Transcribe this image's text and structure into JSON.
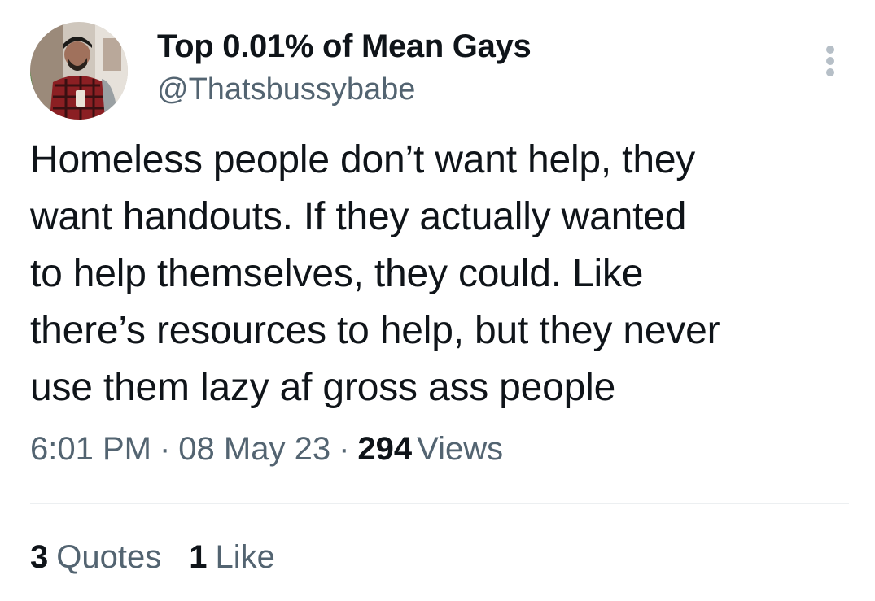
{
  "author": {
    "display_name": "Top 0.01% of Mean Gays",
    "handle": "@Thatsbussybabe"
  },
  "tweet": {
    "text": "Homeless people don’t want help, they\nwant handouts. If they actually wanted\nto help themselves, they could. Like\nthere’s resources to help, but they never\nuse them lazy af gross ass people"
  },
  "meta": {
    "time": "6:01 PM",
    "separator": "·",
    "date": "08 May 23",
    "views_count": "294",
    "views_label": "Views"
  },
  "stats": {
    "quotes_count": "3",
    "quotes_label": "Quotes",
    "likes_count": "1",
    "likes_label": "Like"
  },
  "icons": {
    "more": "more-options-icon"
  },
  "colors": {
    "primary_text": "#0f1419",
    "secondary_text": "#536471",
    "divider": "#eceff1",
    "more_dots": "#b6bfc7"
  }
}
